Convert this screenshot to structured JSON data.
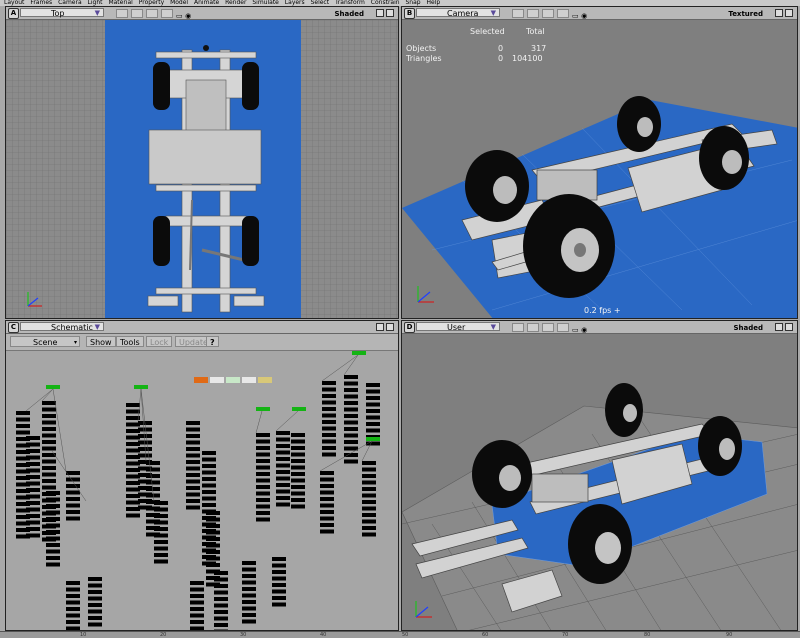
{
  "menu": [
    "Layout",
    "Frames",
    "Camera",
    "Light",
    "Material",
    "Property",
    "Model",
    "Animate",
    "Render",
    "Simulate",
    "Layers",
    "Select",
    "Transform",
    "Constrain",
    "Snap",
    "Help"
  ],
  "viewports": {
    "top": {
      "letter": "A",
      "name": "Top",
      "mode": "Shaded"
    },
    "camera": {
      "letter": "B",
      "name": "Camera",
      "mode": "Textured",
      "stats": {
        "col_selected": "Selected",
        "col_total": "Total",
        "objects_label": "Objects",
        "objects_selected": "0",
        "objects_total": "317",
        "triangles_label": "Triangles",
        "triangles_selected": "0",
        "triangles_total": "104100"
      },
      "fps": "0.2 fps +"
    },
    "schematic": {
      "letter": "C",
      "name": "Schematic",
      "toolbar": {
        "scene": "Scene",
        "show": "Show",
        "tools": "Tools",
        "lock": "Lock",
        "update": "Update",
        "help": "?"
      }
    },
    "user": {
      "letter": "D",
      "name": "User",
      "mode": "Shaded"
    }
  },
  "colors": {
    "floor_blue": "#2a68c4",
    "tire": "#0b0b0b",
    "frame": "#d0d0d0",
    "grid": "#7e7e7e",
    "node_green": "#14b414",
    "node_black": "#000000",
    "node_orange": "#e06a16",
    "node_yellow": "#d8c878"
  },
  "ruler_labels": [
    "10",
    "20",
    "30",
    "40",
    "50",
    "60",
    "70",
    "80",
    "90"
  ]
}
